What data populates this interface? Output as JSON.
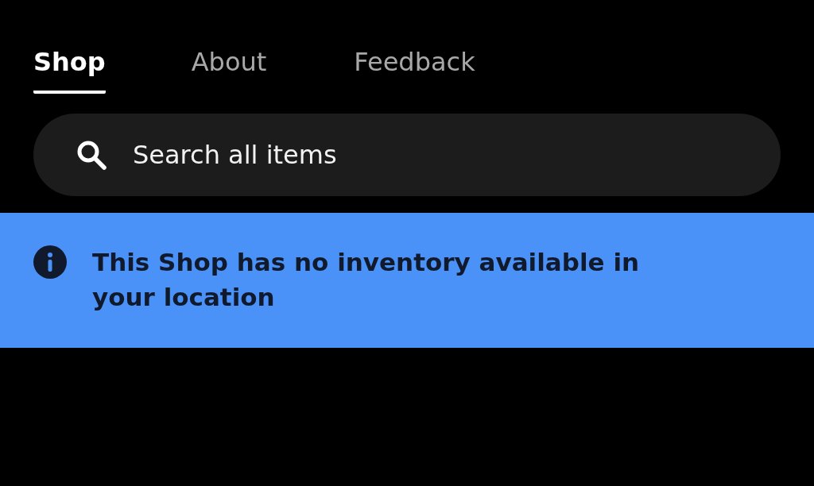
{
  "tabs": [
    {
      "label": "Shop",
      "selected": true
    },
    {
      "label": "About",
      "selected": false
    },
    {
      "label": "Feedback",
      "selected": false
    }
  ],
  "search": {
    "placeholder": "Search all items"
  },
  "notice": {
    "text": "This Shop has no inventory available in your location"
  }
}
